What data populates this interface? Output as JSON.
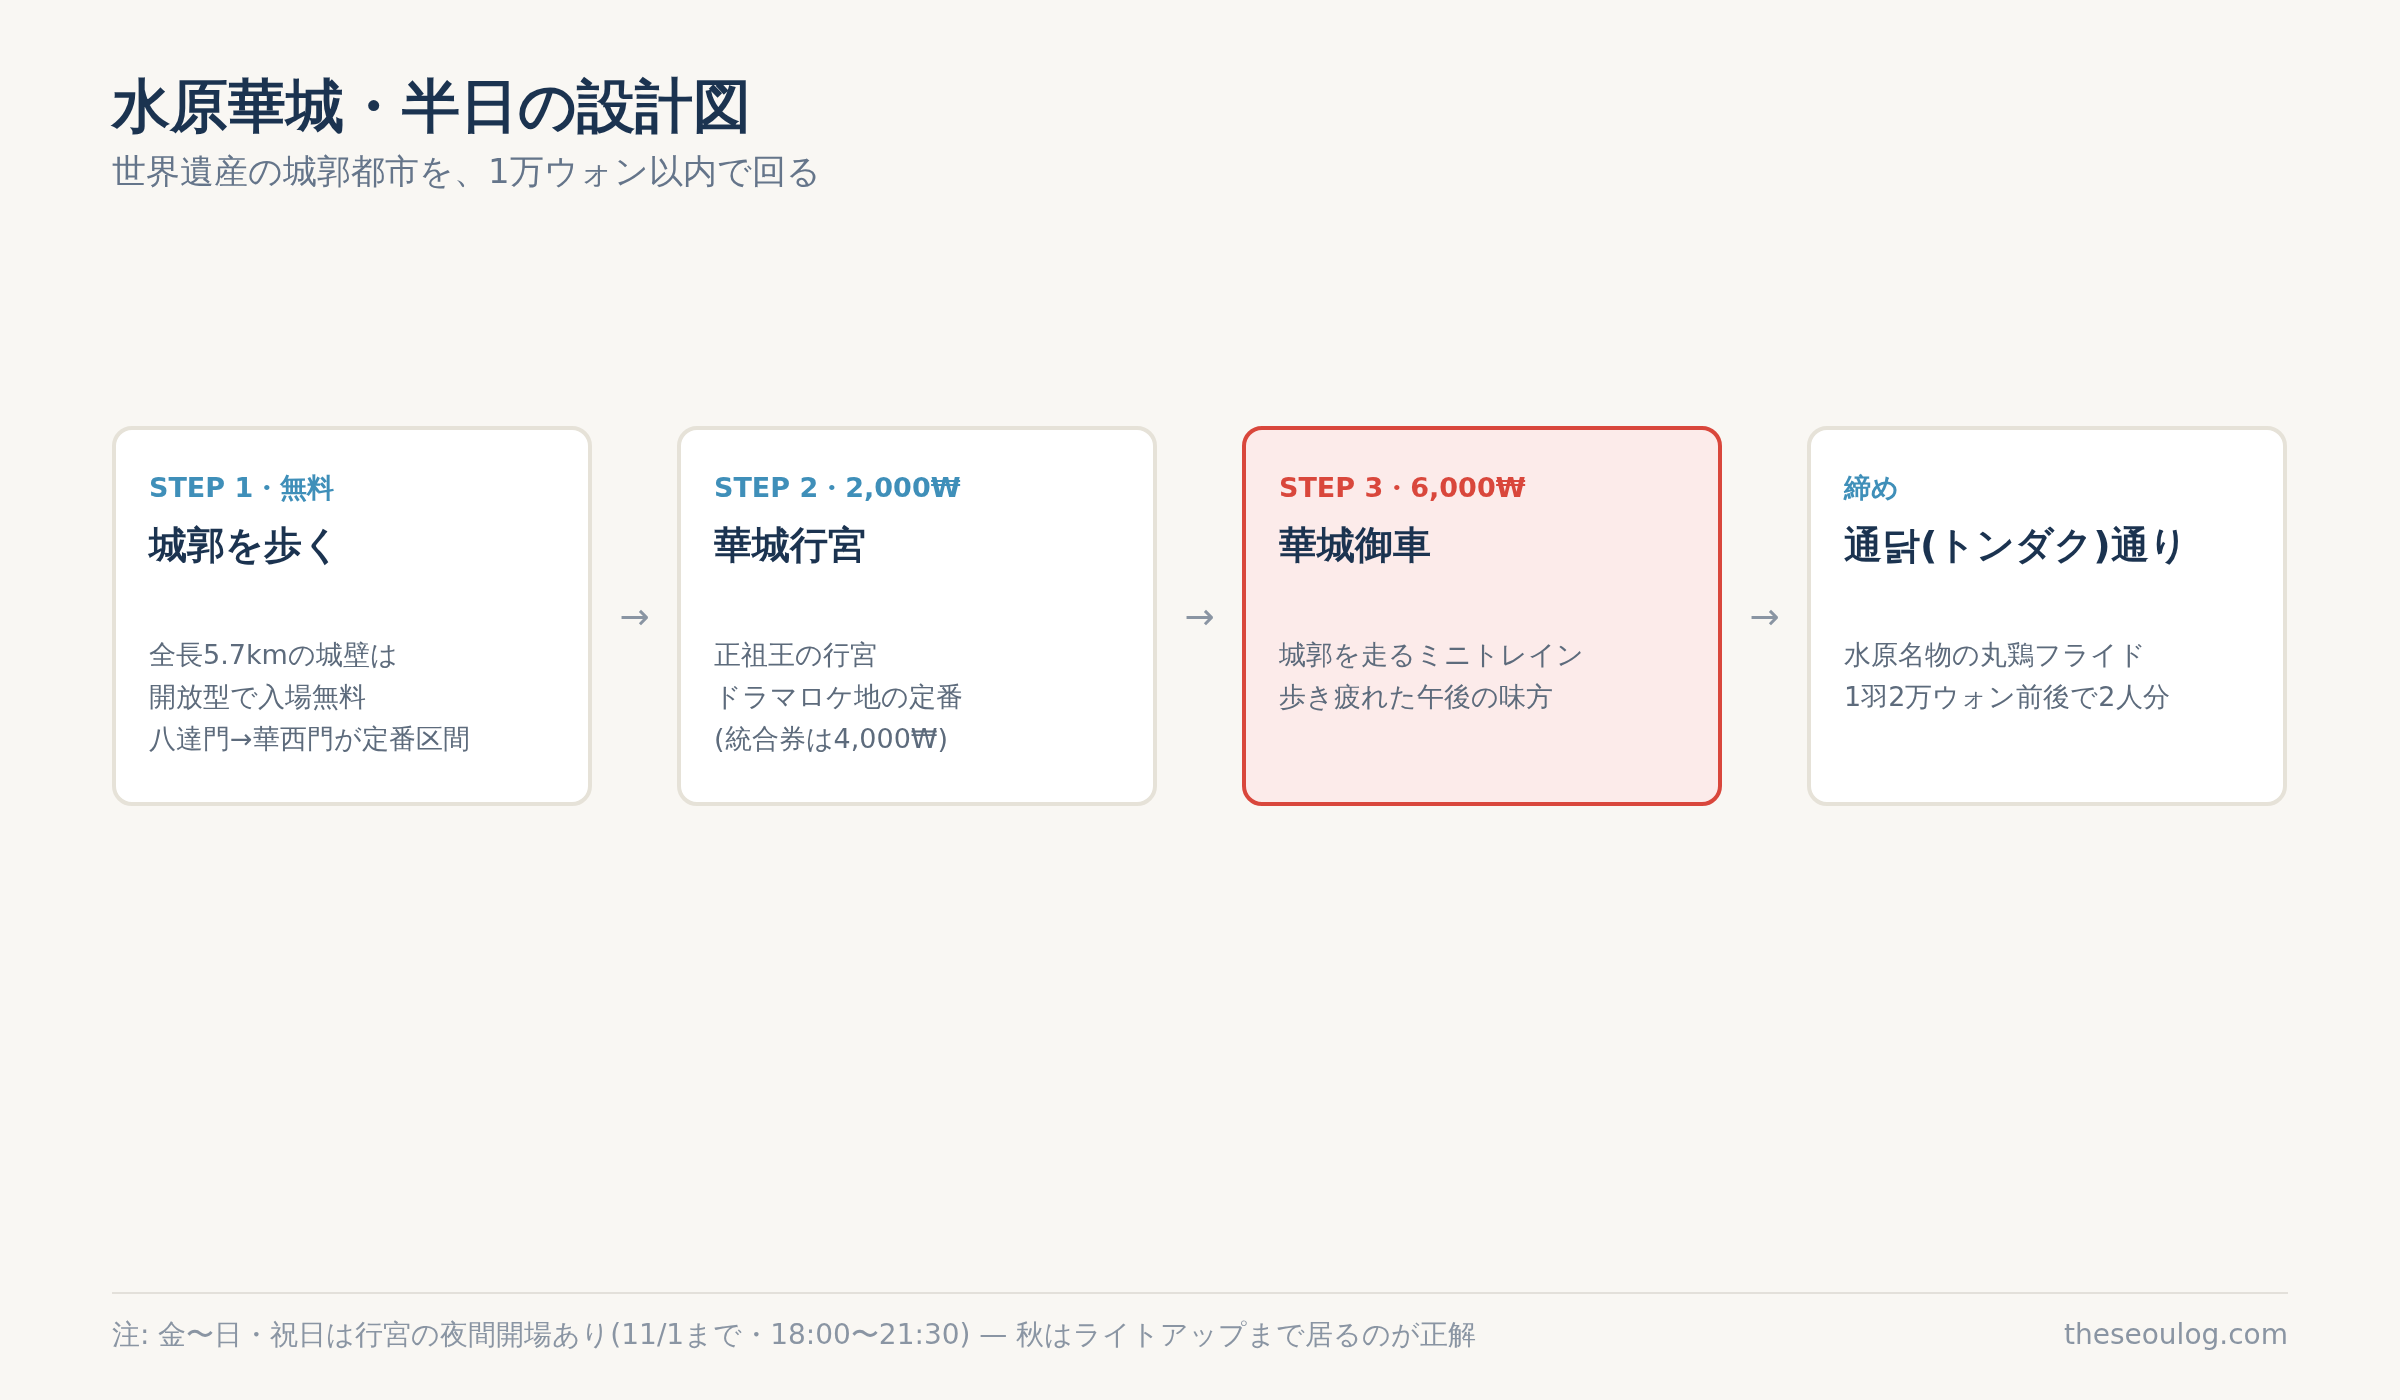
{
  "header": {
    "title": "水原華城・半日の設計図",
    "subtitle": "世界遺産の城郭都市を、1万ウォン以内で回る"
  },
  "steps": [
    {
      "label": "STEP 1・無料",
      "title": "城郭を歩く",
      "description": [
        "全長5.7kmの城壁は",
        "開放型で入場無料",
        "八達門→華西門が定番区間"
      ],
      "highlighted": false,
      "arrow_after": "→"
    },
    {
      "label": "STEP 2・2,000₩",
      "title": "華城行宮",
      "description": [
        "正祖王の行宮",
        "ドラマロケ地の定番",
        "(統合券は4,000₩)"
      ],
      "highlighted": false,
      "arrow_after": "→"
    },
    {
      "label": "STEP 3・6,000₩",
      "title": "華城御車",
      "description": [
        "城郭を走るミニトレイン",
        "歩き疲れた午後の味方"
      ],
      "highlighted": true,
      "arrow_after": "→"
    },
    {
      "label": "締め",
      "title": "通닭(トンダク)通り",
      "description": [
        "水原名物の丸鶏フライド",
        "1羽2万ウォン前後で2人分"
      ],
      "highlighted": false
    }
  ],
  "footer": {
    "note": "注: 金〜日・祝日は行宮の夜間開場あり(11/1まで・18:00〜21:30) — 秋はライトアップまで居るのが正解",
    "site": "theseoulog.com"
  }
}
